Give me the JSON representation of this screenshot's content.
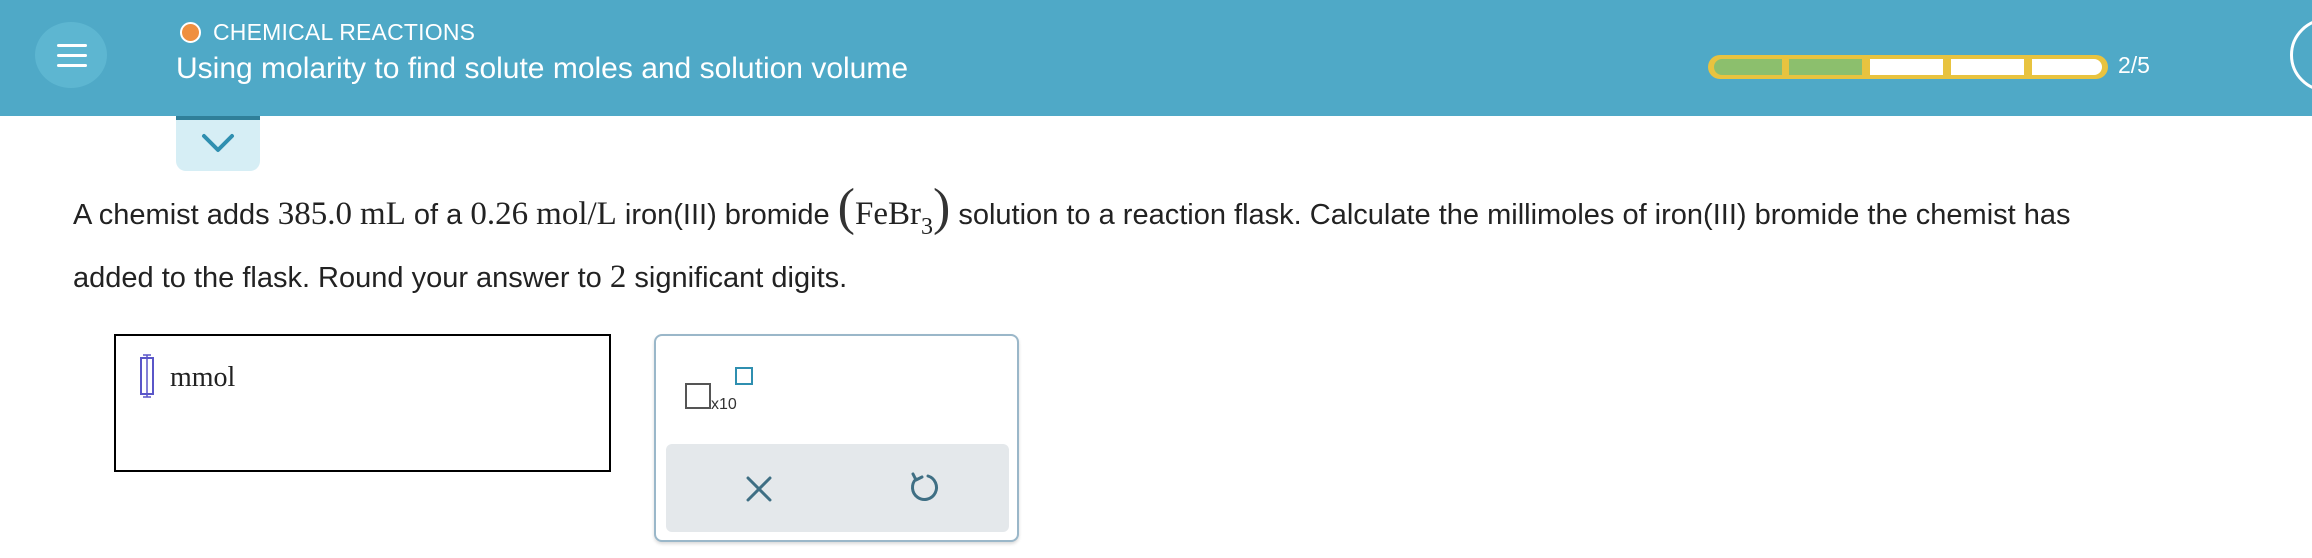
{
  "header": {
    "topic": "CHEMICAL REACTIONS",
    "title": "Using molarity to find solute moles and solution volume",
    "progress_text": "2/5",
    "progress_fraction": 0.4,
    "colors": {
      "background": "#4fa9c7",
      "topic_dot": "#ef8f3f",
      "progress_complete": "#8cbf6d",
      "progress_border": "#e8c33f"
    }
  },
  "question": {
    "p1": "A chemist adds",
    "volume": "385.0",
    "volume_unit": "mL",
    "p2": "of a",
    "molarity": "0.26",
    "molarity_unit": "mol/L",
    "p3": "iron(III) bromide",
    "formula_base": "FeBr",
    "formula_sub": "3",
    "p4": "solution to a reaction flask. Calculate the millimoles of iron(III) bromide the chemist has",
    "p5": "added to the flask. Round your answer to",
    "digits": "2",
    "p6": "significant digits."
  },
  "answer": {
    "value": "",
    "unit": "mmol"
  },
  "tools": {
    "sci_label": "x10",
    "icons": [
      "scientific-notation-icon",
      "clear-icon",
      "undo-icon"
    ]
  }
}
